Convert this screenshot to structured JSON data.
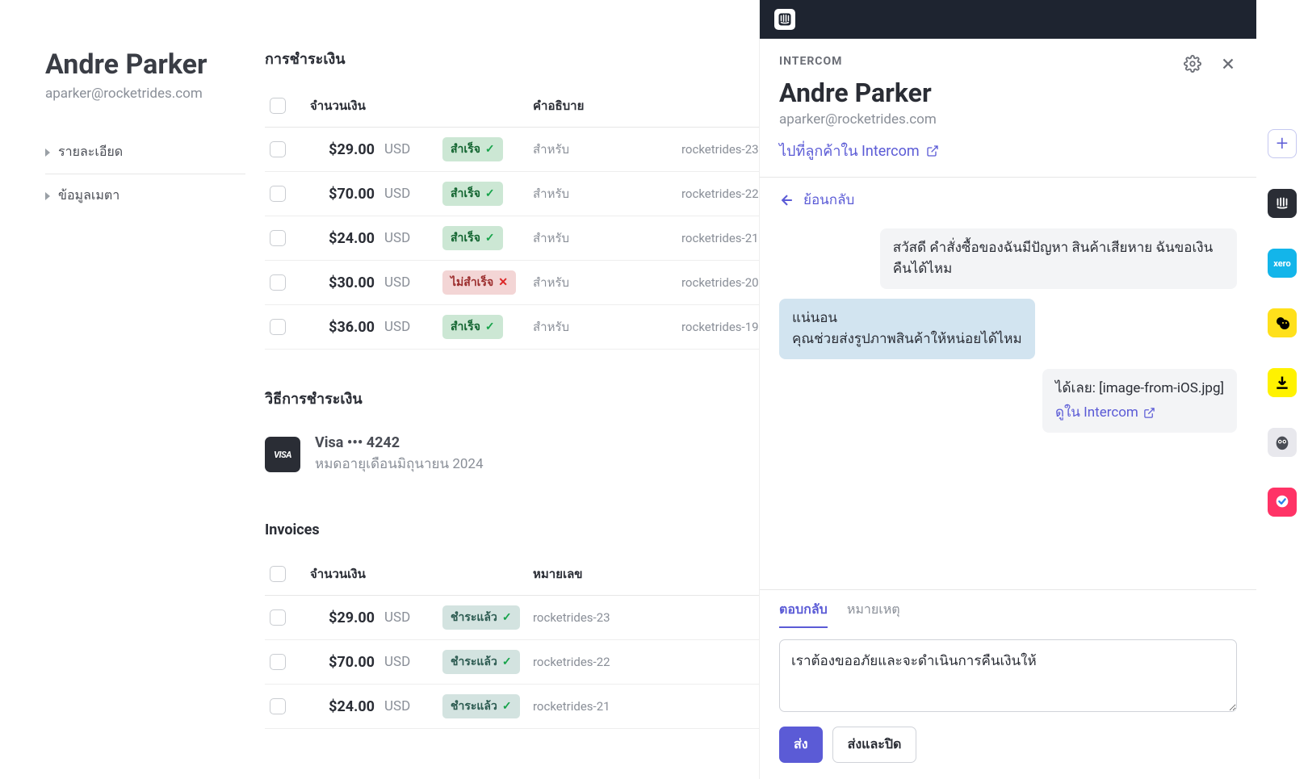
{
  "customer": {
    "name": "Andre Parker",
    "email": "aparker@rocketrides.com"
  },
  "sidebar": {
    "links": [
      "รายละเอียด",
      "ข้อมูลเมตา"
    ]
  },
  "payments": {
    "title": "การชำระเงิน",
    "headers": {
      "amount": "จำนวนเงิน",
      "desc": "คำอธิบาย"
    },
    "rows": [
      {
        "amount": "$29.00",
        "currency": "USD",
        "status": "success",
        "status_label": "สำเร็จ",
        "desc": "สำหรับ",
        "ref": "rocketrides-23"
      },
      {
        "amount": "$70.00",
        "currency": "USD",
        "status": "success",
        "status_label": "สำเร็จ",
        "desc": "สำหรับ",
        "ref": "rocketrides-22"
      },
      {
        "amount": "$24.00",
        "currency": "USD",
        "status": "success",
        "status_label": "สำเร็จ",
        "desc": "สำหรับ",
        "ref": "rocketrides-21"
      },
      {
        "amount": "$30.00",
        "currency": "USD",
        "status": "fail",
        "status_label": "ไม่สำเร็จ",
        "desc": "สำหรับ",
        "ref": "rocketrides-20"
      },
      {
        "amount": "$36.00",
        "currency": "USD",
        "status": "success",
        "status_label": "สำเร็จ",
        "desc": "สำหรับ",
        "ref": "rocketrides-19"
      }
    ]
  },
  "payment_methods": {
    "title": "วิธีการชำระเงิน",
    "card": {
      "brand": "VISA",
      "label": "Visa ••• 4242",
      "expiry": "หมดอายุเดือนมิถุนายน 2024"
    }
  },
  "invoices": {
    "title": "Invoices",
    "headers": {
      "amount": "จำนวนเงิน",
      "number": "หมายเลข"
    },
    "rows": [
      {
        "amount": "$29.00",
        "currency": "USD",
        "status_label": "ชำระแล้ว",
        "ref": "rocketrides-23"
      },
      {
        "amount": "$70.00",
        "currency": "USD",
        "status_label": "ชำระแล้ว",
        "ref": "rocketrides-22"
      },
      {
        "amount": "$24.00",
        "currency": "USD",
        "status_label": "ชำระแล้ว",
        "ref": "rocketrides-21"
      }
    ]
  },
  "panel": {
    "brand": "INTERCOM",
    "name": "Andre Parker",
    "email": "aparker@rocketrides.com",
    "goto_link": "ไปที่ลูกค้าใน Intercom",
    "back": "ย้อนกลับ",
    "messages": {
      "m1": "สวัสดี คำสั่งซื้อของฉันมีปัญหา สินค้าเสียหาย ฉันขอเงินคืนได้ไหม",
      "m2": "แน่นอน\nคุณช่วยส่งรูปภาพสินค้าให้หน่อยได้ไหม",
      "m3_text": "ได้เลย: [image-from-iOS.jpg]",
      "m3_link": "ดูใน Intercom"
    },
    "reply": {
      "tab_reply": "ตอบกลับ",
      "tab_note": "หมายเหตุ",
      "draft": "เราต้องขออภัยและจะดำเนินการคืนเงินให้",
      "send": "ส่ง",
      "send_close": "ส่งและปิด"
    }
  }
}
